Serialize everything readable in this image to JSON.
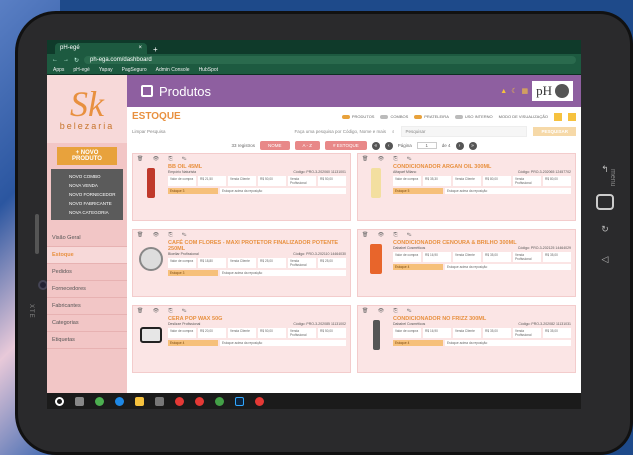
{
  "device": {
    "brand": "XTE",
    "side_label": "menu"
  },
  "browser": {
    "tab_title": "pH-egé",
    "url": "ph-ega.com/dashboard",
    "bookmarks": [
      "Apps",
      "pH-egé",
      "Yapay",
      "PagSeguro",
      "Admin Console",
      "HubSpot"
    ]
  },
  "sidebar": {
    "logo_mark": "Sk",
    "logo_text": "belezaria",
    "new_product_button": "+ NOVO PRODUTO",
    "submenu": [
      "NOVO COMBO",
      "NOVA VENDA",
      "NOVO FORNECEDOR",
      "NOVO FABRICANTE",
      "NOVA CATEGORIA"
    ],
    "nav": [
      "Visão Geral",
      "Estoque",
      "Pedidos",
      "Fornecedores",
      "Fabricantes",
      "Categorias",
      "Etiquetas"
    ],
    "active_index": 1
  },
  "header": {
    "title": "Produtos",
    "brand_badge": "pH"
  },
  "toolbar": {
    "section_title": "ESTOQUE",
    "toggles": [
      "PRODUTOS",
      "COMBOS",
      "PRATELEIRA",
      "USO INTERNO"
    ],
    "view_mode_label": "MODO DE VISUALIZAÇÃO",
    "clear_search": "Limpar Pesquisa",
    "search_hint": "Faça uma pesquisa por Código, Nome e mais",
    "search_placeholder": "Pesquisar",
    "search_button": "PESQUISAR",
    "records": "33 registros",
    "sort_name": "NOME",
    "sort_order": "A - Z",
    "filter": "# ESTOQUE",
    "page_label": "Página",
    "page_value": "1",
    "page_total": "de 4"
  },
  "product_labels": {
    "tools": "🗑 👁 ⎘ ✎",
    "buy": "Valor de compra",
    "sale": "Venda Cliente",
    "pro": "Venda Profissional",
    "stock": "Estoque",
    "stock_note": "Estoque acima da reposição"
  },
  "products": [
    {
      "name": "BB OIL 45ML",
      "brand": "Empório Naturista",
      "code": "Código: PRO-3-202060 11131001",
      "buy": "R$ 21,50",
      "sale": "R$ 50,00",
      "pro": "R$ 50,00",
      "stock": "3"
    },
    {
      "name": "CONDICIONADOR ARGAN OIL 300ML",
      "brand": "Alfaparf Milano",
      "code": "Código: PRO-3-202065 12457702",
      "buy": "R$ 35,30",
      "sale": "R$ 80,00",
      "pro": "R$ 80,00",
      "stock": "5"
    },
    {
      "name": "CAFÉ COM FLORES - MAXI PROTETOR FINALIZADOR POTENTE 250ML",
      "brand": "Bioeliar Profissional",
      "code": "Código: PRO-3-202110 14464030",
      "buy": "R$ 18,80",
      "sale": "R$ 25,00",
      "pro": "R$ 25,00",
      "stock": "3"
    },
    {
      "name": "CONDICIONADOR CENOURA & BRILHO 300ML",
      "brand": "Dababel Cosméticos",
      "code": "Código: PRO-3-202125 14464029",
      "buy": "R$ 16,90",
      "sale": "R$ 35,00",
      "pro": "R$ 35,00",
      "stock": "4"
    },
    {
      "name": "CERA POP WAX 50G",
      "brand": "Deslizze Profissional",
      "code": "Código: PRO-3-202085 11131002",
      "buy": "R$ 20,00",
      "sale": "R$ 50,00",
      "pro": "R$ 50,00",
      "stock": "4"
    },
    {
      "name": "CONDICIONADOR NO FRIZZ 300ML",
      "brand": "Dababel Cosméticos",
      "code": "Código: PRO-3-202082 11131031",
      "buy": "R$ 16,90",
      "sale": "R$ 35,00",
      "pro": "R$ 35,00",
      "stock": "4"
    }
  ],
  "colors": {
    "accent": "#e8903f",
    "header": "#8e5fa0",
    "card": "#fbe5e5",
    "sidebar": "#f2c6c6"
  }
}
